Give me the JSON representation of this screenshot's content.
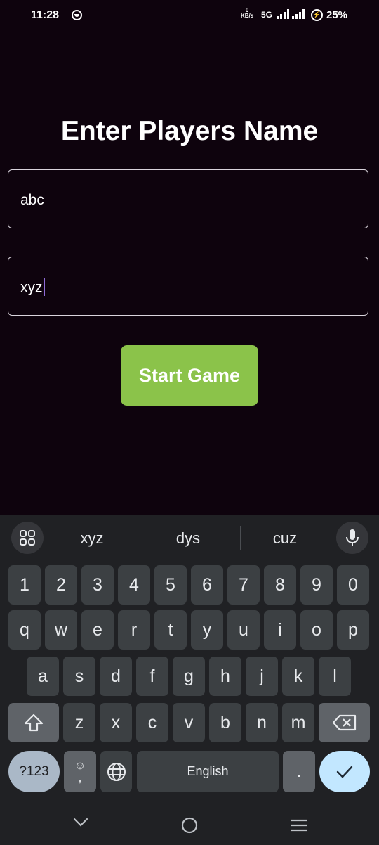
{
  "status_bar": {
    "time": "11:28",
    "net_speed_value": "0",
    "net_speed_unit": "KB/s",
    "network": "5G",
    "battery": "25%"
  },
  "screen": {
    "title": "Enter Players Name",
    "player1_value": "abc",
    "player2_value": "xyz",
    "start_label": "Start Game"
  },
  "keyboard": {
    "suggestions": [
      "xyz",
      "dys",
      "cuz"
    ],
    "row_numbers": [
      "1",
      "2",
      "3",
      "4",
      "5",
      "6",
      "7",
      "8",
      "9",
      "0"
    ],
    "row1": [
      "q",
      "w",
      "e",
      "r",
      "t",
      "y",
      "u",
      "i",
      "o",
      "p"
    ],
    "row2": [
      "a",
      "s",
      "d",
      "f",
      "g",
      "h",
      "j",
      "k",
      "l"
    ],
    "row3": [
      "z",
      "x",
      "c",
      "v",
      "b",
      "n",
      "m"
    ],
    "symbols_label": "?123",
    "comma_label": ",",
    "space_label": "English",
    "period_label": ".",
    "accent_color": "#c2e7ff"
  }
}
